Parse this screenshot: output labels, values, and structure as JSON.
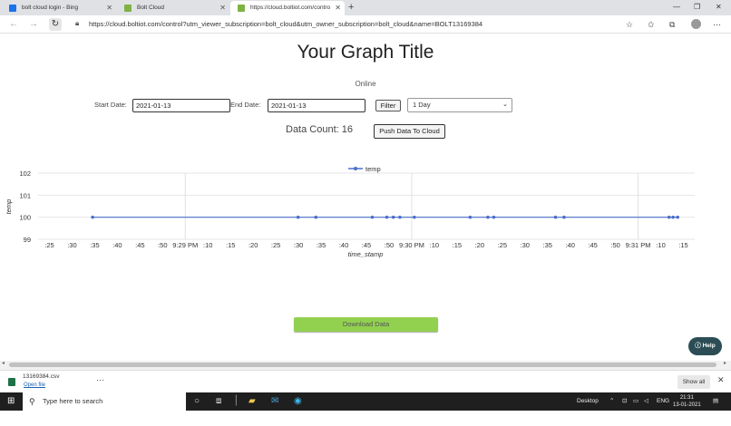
{
  "browser": {
    "tabs": [
      {
        "title": "bolt cloud login - Bing",
        "favicon_color": "#1a73e8"
      },
      {
        "title": "Bolt Cloud",
        "favicon_color": "#7cb342"
      },
      {
        "title": "https://cloud.boltiot.com/contro",
        "favicon_color": "#7cb342"
      }
    ],
    "url": "https://cloud.boltiot.com/control?utm_viewer_subscription=bolt_cloud&utm_owner_subscription=bolt_cloud&name=BOLT13169384"
  },
  "page": {
    "title": "Your Graph Title",
    "status": "Online",
    "start_label": "Start Date:",
    "start_value": "2021-01-13",
    "end_label": "End Date:",
    "end_value": "2021-01-13",
    "filter_label": "Filter",
    "range_option": "1 Day",
    "data_count_label": "Data Count: 16",
    "push_label": "Push Data To Cloud",
    "download_label": "Download Data",
    "help_label": "Help"
  },
  "chart_data": {
    "type": "line",
    "series": [
      {
        "name": "temp",
        "color": "#4a6fc9",
        "x_pos": [
          0.083,
          0.396,
          0.423,
          0.509,
          0.531,
          0.541,
          0.551,
          0.573,
          0.658,
          0.685,
          0.694,
          0.788,
          0.801,
          0.961,
          0.967,
          0.974
        ],
        "values": [
          100,
          100,
          100,
          100,
          100,
          100,
          100,
          100,
          100,
          100,
          100,
          100,
          100,
          100,
          100,
          100
        ]
      }
    ],
    "xlabel": "time_stamp",
    "ylabel": "temp",
    "ylim": [
      99,
      102
    ],
    "yticks": [
      "102",
      "101",
      "100",
      "99"
    ],
    "xticks": [
      ":25",
      ":30",
      ":35",
      ":40",
      ":45",
      ":50",
      "9:29 PM",
      ":10",
      ":15",
      ":20",
      ":25",
      ":30",
      ":35",
      ":40",
      ":45",
      ":50",
      "9:30 PM",
      ":10",
      ":15",
      ":20",
      ":25",
      ":30",
      ":35",
      ":40",
      ":45",
      ":50",
      "9:31 PM",
      ":10",
      ":15"
    ],
    "legend": "top-center",
    "grid": true
  },
  "downloads": {
    "file": "13169384.csv",
    "action": "Open file",
    "show_all": "Show all"
  },
  "taskbar": {
    "search_placeholder": "Type here to search",
    "desktop": "Desktop",
    "lang": "ENG",
    "time": "21:31",
    "date": "13-01-2021"
  }
}
